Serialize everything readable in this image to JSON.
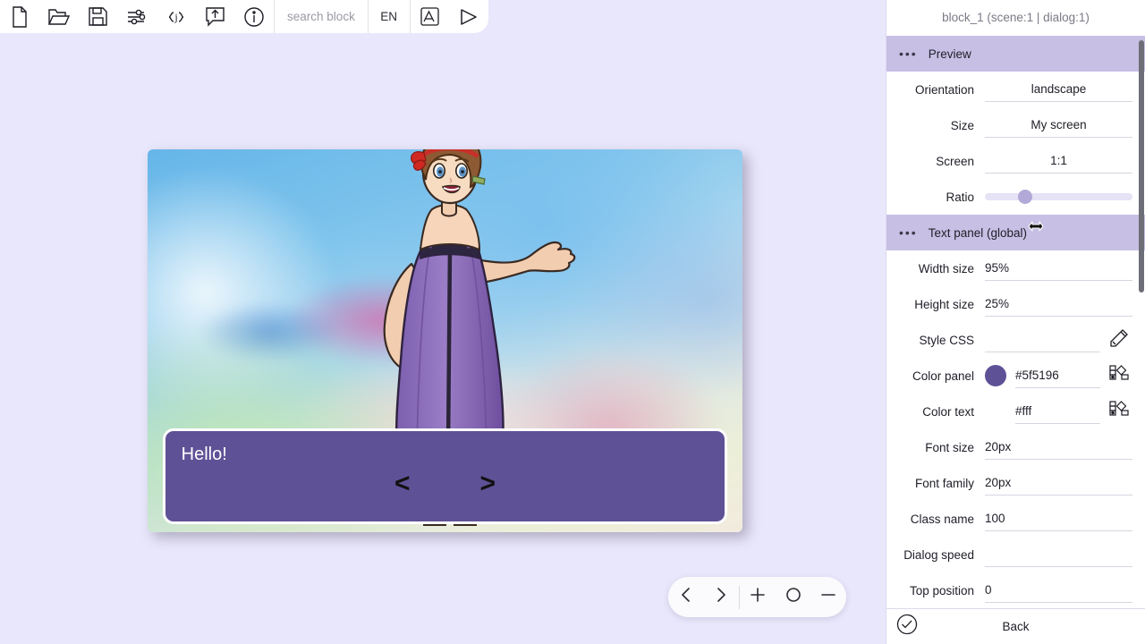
{
  "toolbar": {
    "buttons": [
      {
        "name": "new-file-icon",
        "label": "New"
      },
      {
        "name": "open-folder-icon",
        "label": "Open"
      },
      {
        "name": "save-icon",
        "label": "Save"
      },
      {
        "name": "settings-sliders-icon",
        "label": "Settings"
      },
      {
        "name": "json-braces-icon",
        "label": "{j}"
      },
      {
        "name": "export-bubble-icon",
        "label": "Export"
      },
      {
        "name": "info-icon",
        "label": "Info"
      }
    ],
    "search_placeholder": "search block",
    "language": "EN",
    "font-icon-label": "Font",
    "play_label": "Play"
  },
  "preview": {
    "dialog": {
      "text": "Hello!",
      "prev_arrow": "<",
      "next_arrow": ">",
      "panel_color": "#5f5196",
      "text_color": "#fff",
      "width_pct": "95%",
      "height_pct": "25%"
    }
  },
  "zoombar": {
    "prev_label": "Previous",
    "next_label": "Next",
    "zoom_in_label": "+",
    "reset_label": "Reset",
    "zoom_out_label": "−"
  },
  "panel": {
    "title": "block_1 (scene:1 | dialog:1)",
    "sections": [
      {
        "name": "preview",
        "title": "Preview",
        "rows": [
          {
            "label": "Orientation",
            "value": "landscape",
            "type": "text-center"
          },
          {
            "label": "Size",
            "value": "My screen",
            "type": "text-center"
          },
          {
            "label": "Screen",
            "value": "1:1",
            "type": "text-center"
          },
          {
            "label": "Ratio",
            "value": "",
            "type": "slider",
            "slider_pos": "27%"
          }
        ]
      },
      {
        "name": "text-panel-global",
        "title": "Text panel (global)",
        "rows": [
          {
            "label": "Width size",
            "value": "95%",
            "type": "text"
          },
          {
            "label": "Height size",
            "value": "25%",
            "type": "text"
          },
          {
            "label": "Style CSS",
            "value": "",
            "type": "text",
            "icon": "pencil-icon"
          },
          {
            "label": "Color panel",
            "value": "#5f5196",
            "type": "color",
            "swatch": "#5f5196",
            "icon": "color-picker-icon"
          },
          {
            "label": "Color text",
            "value": "#fff",
            "type": "color-noswatch",
            "icon": "color-picker-icon"
          },
          {
            "label": "Font size",
            "value": "20px",
            "type": "text"
          },
          {
            "label": "Font family",
            "value": "20px",
            "type": "text"
          },
          {
            "label": "Class name",
            "value": "100",
            "type": "text"
          },
          {
            "label": "Dialog speed",
            "value": "",
            "type": "text"
          },
          {
            "label": "Top position",
            "value": "0",
            "type": "text"
          }
        ]
      }
    ],
    "footer": {
      "confirm_label": "Confirm",
      "back_label": "Back"
    },
    "header_color": "#c7bfe4"
  }
}
